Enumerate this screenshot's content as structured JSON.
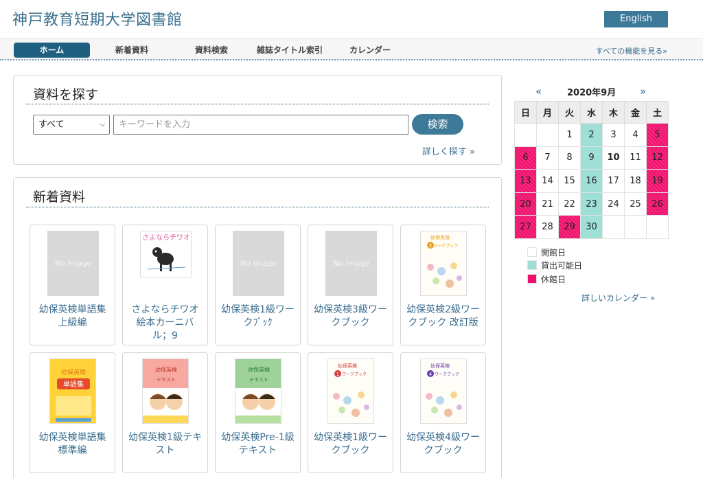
{
  "header": {
    "site_title": "神戸教育短期大学図書館",
    "language_button": "English"
  },
  "nav": {
    "items": [
      "ホーム",
      "新着資料",
      "資料検索",
      "雑誌タイトル索引",
      "カレンダー"
    ],
    "all_features": "すべての機能を見る»"
  },
  "search": {
    "title": "資料を探す",
    "scope_selected": "すべて",
    "keyword_placeholder": "キーワードを入力",
    "submit": "検索",
    "advanced_link": "詳しく探す »"
  },
  "new_arrivals": {
    "title": "新着資料",
    "no_image_text": "No Image",
    "books": [
      "幼保英検単語集上級編",
      "さよならチワオ絵本カーニバル；9",
      "幼保英検1級ワークﾌﾞｯｸ",
      "幼保英検3級ワークブック",
      "幼保英検2級ワークブック 改訂版",
      "幼保英検単語集標準編",
      "幼保英検1級テキスト",
      "幼保英検Pre-1級テキスト",
      "幼保英検1級ワークブック",
      "幼保英検4級ワークブック"
    ],
    "cover_text": {
      "chiwao": "さよならチワオ",
      "yoho_eiken": "幼保英検",
      "workbook": "ワークブック",
      "text": "テキスト",
      "tangoshu": "単語集"
    }
  },
  "calendar": {
    "prev": "«",
    "next": "»",
    "month_label": "2020年9月",
    "weekdays": [
      "日",
      "月",
      "火",
      "水",
      "木",
      "金",
      "土"
    ],
    "weeks": [
      [
        "",
        "",
        "1",
        "2",
        "3",
        "4",
        "5"
      ],
      [
        "6",
        "7",
        "8",
        "9",
        "10",
        "11",
        "12"
      ],
      [
        "13",
        "14",
        "15",
        "16",
        "17",
        "18",
        "19"
      ],
      [
        "20",
        "21",
        "22",
        "23",
        "24",
        "25",
        "26"
      ],
      [
        "27",
        "28",
        "29",
        "30",
        "",
        "",
        ""
      ]
    ],
    "legend": {
      "open": "開館日",
      "lending": "貸出可能日",
      "closed": "休館日"
    },
    "detail_link": "詳しいカレンダー »",
    "colors": {
      "closed": "#f0106c",
      "lending": "#9fe0d6",
      "open": "#ffffff"
    }
  }
}
